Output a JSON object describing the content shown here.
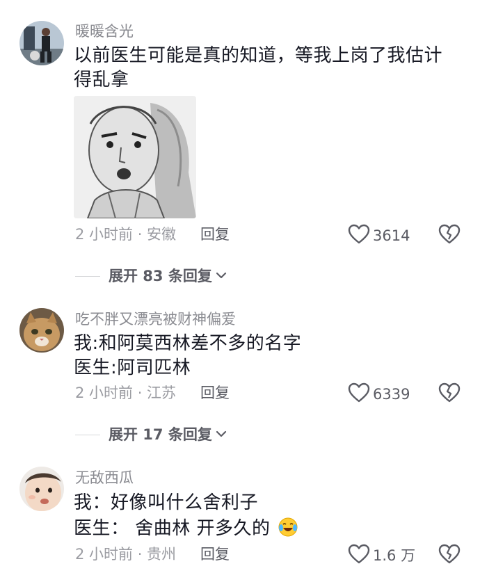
{
  "comments": [
    {
      "username": "暖暖含光",
      "lines": [
        "以前医生可能是真的知道，等我上岗了我估计",
        "得乱拿"
      ],
      "time_location": "2 小时前 · 安徽",
      "reply_label": "回复",
      "like_count": "3614",
      "expand_label": "展开 83 条回复"
    },
    {
      "username": "吃不胖又漂亮被财神偏爱",
      "lines": [
        "我:和阿莫西林差不多的名字",
        "医生:阿司匹林"
      ],
      "time_location": "2 小时前 · 江苏",
      "reply_label": "回复",
      "like_count": "6339",
      "expand_label": "展开 17 条回复"
    },
    {
      "username": "无敌西瓜",
      "lines": [
        "我：好像叫什么舍利子",
        "医生： 舍曲林 开多久的"
      ],
      "time_location": "2 小时前 · 贵州",
      "reply_label": "回复",
      "like_count": "1.6 万"
    }
  ],
  "icons": {
    "like": "heart-outline-icon",
    "dislike": "broken-heart-icon",
    "expand": "chevron-down-icon",
    "emoji": "crying-laughing-emoji"
  },
  "colors": {
    "text_primary": "#161823",
    "text_secondary": "#8a8b91",
    "action_gray": "#5a5b63"
  }
}
